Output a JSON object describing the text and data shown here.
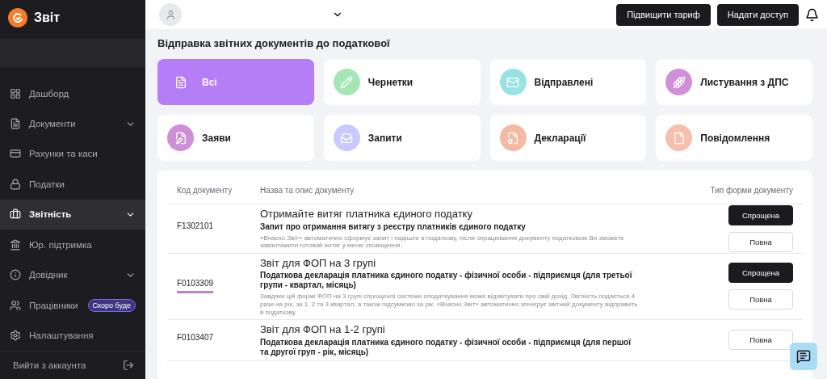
{
  "sidebar": {
    "logo": "Звіт",
    "items": [
      {
        "label": "Дашборд",
        "selected": false,
        "expandable": false
      },
      {
        "label": "Документи",
        "selected": false,
        "expandable": true
      },
      {
        "label": "Рахунки та каси",
        "selected": false,
        "expandable": false
      },
      {
        "label": "Податки",
        "selected": false,
        "expandable": false
      },
      {
        "label": "Звітність",
        "selected": true,
        "expandable": true
      },
      {
        "label": "Юр. підтримка",
        "selected": false,
        "expandable": false
      },
      {
        "label": "Довідник",
        "selected": false,
        "expandable": true
      },
      {
        "label": "Працівники",
        "selected": false,
        "expandable": false,
        "badge": "Скоро буде"
      },
      {
        "label": "Налаштування",
        "selected": false,
        "expandable": false
      }
    ],
    "logout": "Вийти з аккаунта"
  },
  "topbar": {
    "buttons": [
      "Підвищити тариф",
      "Надати доступ"
    ]
  },
  "page_title": "Відправка звітних документів до податкової",
  "categories": [
    {
      "label": "Всі",
      "selected": true,
      "color": "#b57ef7"
    },
    {
      "label": "Чернетки",
      "selected": false,
      "color": "#a6e6b5"
    },
    {
      "label": "Відправлені",
      "selected": false,
      "color": "#97e3e3"
    },
    {
      "label": "Листування з ДПС",
      "selected": false,
      "color": "#d08fd8"
    },
    {
      "label": "Заяви",
      "selected": false,
      "color": "#cf8fd6"
    },
    {
      "label": "Запити",
      "selected": false,
      "color": "#c9c9fb"
    },
    {
      "label": "Декларації",
      "selected": false,
      "color": "#f6b9a3"
    },
    {
      "label": "Повідомлення",
      "selected": false,
      "color": "#f6bfae"
    }
  ],
  "table": {
    "columns": [
      "Код документу",
      "Назва та опис документу",
      "Тип форми документу"
    ],
    "rows": [
      {
        "code": "F1302101",
        "highlighted": false,
        "title": "Отримайте витяг платника єдиного податку",
        "subtitle": "Запит про отримання витягу з реєстру платників єдиного податку",
        "description": "«Вчасно.Звіт» автоматично сформує запит і надішле в податкову, після опрацювання документу податковою Ви зможете завантажити готовий витяг у меню сповіщення.",
        "forms": [
          {
            "label": "Спрощена",
            "kind": "primary"
          },
          {
            "label": "Повна",
            "kind": "outline"
          }
        ]
      },
      {
        "code": "F0103309",
        "highlighted": true,
        "title": "Звіт для ФОП на 3 групі",
        "subtitle": "Податкова декларація платника єдиного податку - фізичної особи - підприємця (для третьої групи - квартал, місяць)",
        "description": "Завдяки цій формі ФОП на 3 групі спрощеної системи оподаткування може відзвітувати про свій дохід. Звітність подається 4 рази на рік, за 1, 2 та 3 квартал, а також підсумково за рік. «Вчасно.Звіт» автоматично згенерує звітний документу відправить в податкову.",
        "forms": [
          {
            "label": "Спрощена",
            "kind": "primary"
          },
          {
            "label": "Повна",
            "kind": "outline"
          }
        ]
      },
      {
        "code": "F0103407",
        "highlighted": false,
        "title": "Звіт для ФОП на 1-2 групі",
        "subtitle": "Податкова декларація платника єдиного податку - фізичної особи - підприємця (для першої та другої груп - рік, місяць)",
        "forms": [
          {
            "label": "Повна",
            "kind": "outline"
          }
        ]
      }
    ]
  }
}
